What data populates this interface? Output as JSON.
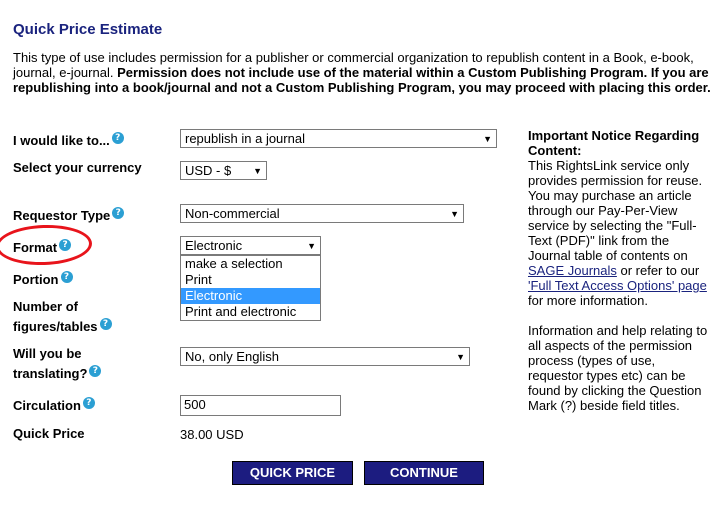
{
  "header": {
    "title": "Quick Price Estimate"
  },
  "intro": {
    "plain": "This type of use includes permission for a publisher or commercial organization to republish content in a Book, e-book, journal, e-journal. ",
    "bold": "Permission does not include use of the material within a Custom Publishing Program. If you are republishing into a book/journal and not a Custom Publishing Program, you may proceed with placing this order."
  },
  "form": {
    "like_to": {
      "label": "I would like to...",
      "value": "republish in a journal"
    },
    "currency": {
      "label": "Select your currency",
      "value": "USD - $"
    },
    "requestor": {
      "label": "Requestor Type",
      "value": "Non-commercial"
    },
    "format": {
      "label": "Format",
      "value": "Electronic",
      "options": [
        "make a selection",
        "Print",
        "Electronic",
        "Print and electronic"
      ],
      "highlighted_index": 2
    },
    "portion": {
      "label": "Portion"
    },
    "figures": {
      "label": "Number of figures/tables"
    },
    "translating": {
      "label": "Will you be translating?",
      "value": "No, only English"
    },
    "circulation": {
      "label": "Circulation",
      "value": "500"
    },
    "quick_price": {
      "label": "Quick Price",
      "value": "38.00 USD"
    },
    "help_glyph": "?"
  },
  "notice": {
    "heading": "Important Notice Regarding Content:",
    "p1_a": "This RightsLink service only provides permission for reuse. You may purchase an article through our Pay-Per-View service by selecting the \"Full-Text (PDF)\" link from the Journal table of contents on ",
    "p1_link1": "SAGE Journals",
    "p1_b": " or refer to our ",
    "p1_link2": "'Full Text Access Options' page",
    "p1_c": " for more information.",
    "p2": "Information and help relating to all aspects of the permission process (types of use, requestor types etc) can be found by clicking the Question Mark (?) beside field titles."
  },
  "buttons": {
    "quick_price": "QUICK PRICE",
    "continue": "CONTINUE"
  },
  "annotation_color": "#e8141b",
  "accent_color": "#1c1c80"
}
